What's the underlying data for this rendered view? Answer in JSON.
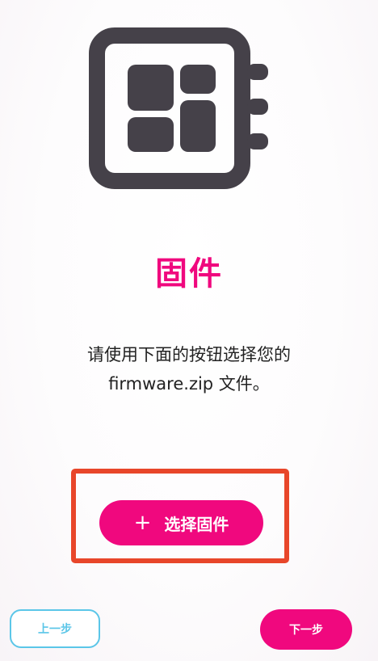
{
  "icon": {
    "name": "firmware-chip-icon",
    "color": "#454149"
  },
  "title": "固件",
  "description": {
    "line1": "请使用下面的按钮选择您的",
    "line2": "firmware.zip 文件。"
  },
  "select_button": {
    "icon": "plus-icon",
    "icon_glyph": "+",
    "label": "选择固件"
  },
  "navigation": {
    "prev_label": "上一步",
    "next_label": "下一步"
  },
  "colors": {
    "accent": "#f0087e",
    "secondary": "#5bc6e8",
    "highlight": "#e8462a",
    "icon": "#454149"
  }
}
